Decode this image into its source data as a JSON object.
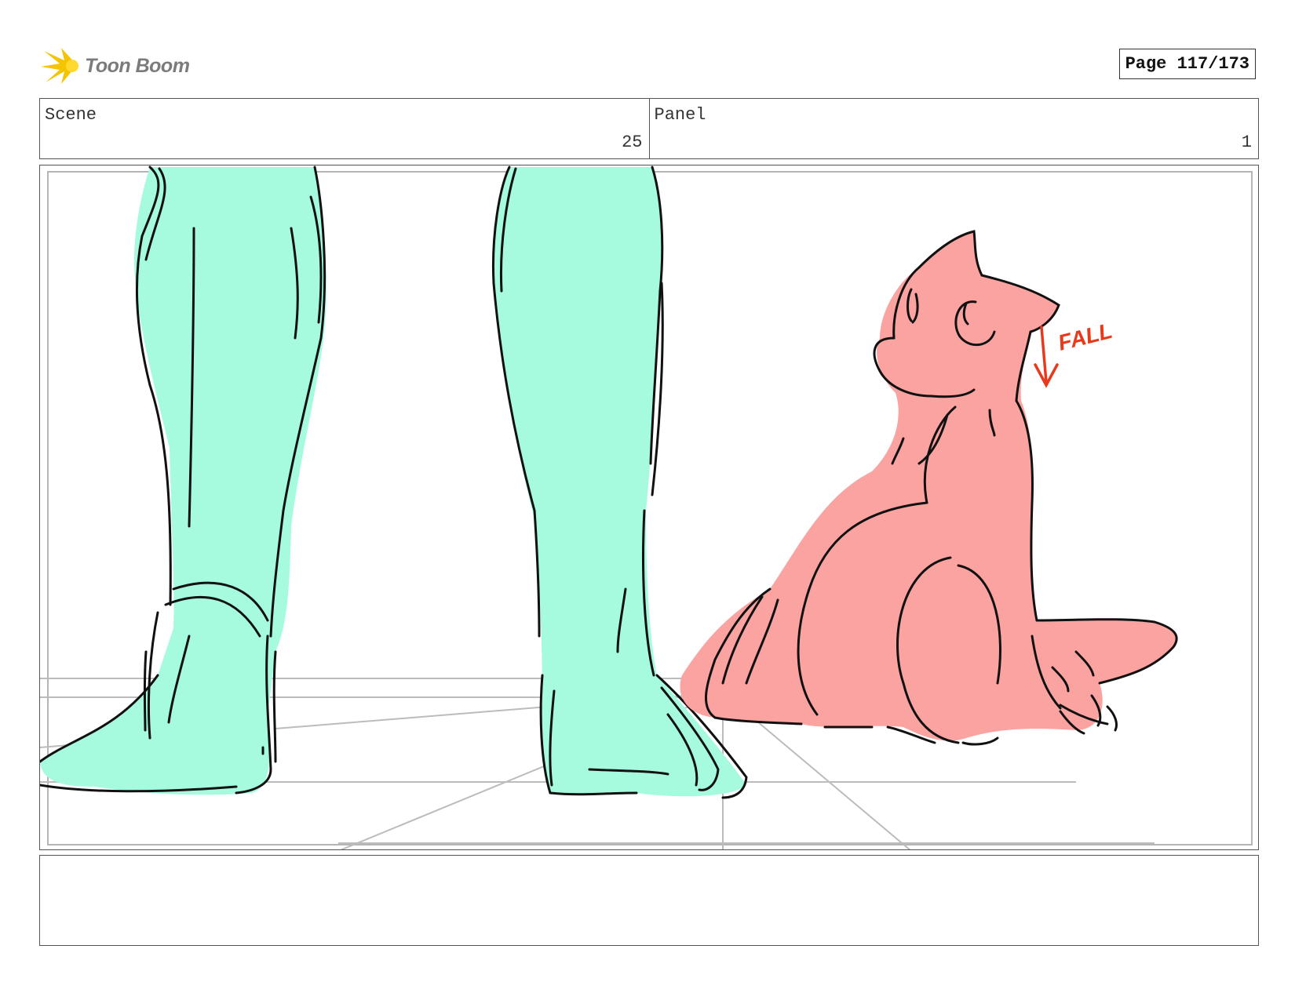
{
  "brand": {
    "name": "Toon Boom",
    "logo_icon": "starburst-icon",
    "accent": "#f5c400"
  },
  "page": {
    "label": "Page 117/173"
  },
  "header": {
    "scene_label": "Scene",
    "scene_value": "25",
    "panel_label": "Panel",
    "panel_value": "1"
  },
  "drawing": {
    "annotation": "FALL",
    "colors": {
      "legs": "#a6fbde",
      "creature": "#fba3a0",
      "ink": "#111111",
      "annotation": "#e8391d",
      "guides": "#bcbcbc"
    }
  },
  "notes": {
    "text": ""
  }
}
